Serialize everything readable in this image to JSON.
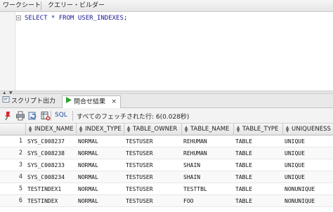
{
  "editor_tabs": {
    "worksheet": "ワークシート",
    "query_builder": "クエリー・ビルダー"
  },
  "editor": {
    "sql": "SELECT * FROM USER_INDEXES;"
  },
  "result_tabs": {
    "script_output": "スクリプト出力",
    "query_result": "問合せ結果",
    "close_symbol": "×"
  },
  "toolbar": {
    "sql_label": "SQL",
    "status": "すべてのフェッチされた行: 6(0.028秒)"
  },
  "grid": {
    "columns": [
      "INDEX_NAME",
      "INDEX_TYPE",
      "TABLE_OWNER",
      "TABLE_NAME",
      "TABLE_TYPE",
      "UNIQUENESS"
    ],
    "rows": [
      {
        "num": "1",
        "cells": [
          "SYS_C008237",
          "NORMAL",
          "TESTUSER",
          "REHUMAN",
          "TABLE",
          "UNIQUE"
        ]
      },
      {
        "num": "2",
        "cells": [
          "SYS_C008238",
          "NORMAL",
          "TESTUSER",
          "REHUMAN",
          "TABLE",
          "UNIQUE"
        ]
      },
      {
        "num": "3",
        "cells": [
          "SYS_C008233",
          "NORMAL",
          "TESTUSER",
          "SHAIN",
          "TABLE",
          "UNIQUE"
        ]
      },
      {
        "num": "4",
        "cells": [
          "SYS_C008234",
          "NORMAL",
          "TESTUSER",
          "SHAIN",
          "TABLE",
          "UNIQUE"
        ]
      },
      {
        "num": "5",
        "cells": [
          "TESTINDEX1",
          "NORMAL",
          "TESTUSER",
          "TESTTBL",
          "TABLE",
          "NONUNIQUE"
        ]
      },
      {
        "num": "6",
        "cells": [
          "TESTINDEX",
          "NORMAL",
          "TESTUSER",
          "FOO",
          "TABLE",
          "NONUNIQUE"
        ]
      }
    ]
  },
  "icons": {
    "pin": "pin-icon",
    "print": "print-icon",
    "refresh": "refresh-icon",
    "export": "export-icon",
    "script": "script-output-icon",
    "run": "run-icon",
    "sort": "sort-icon",
    "collapse": "collapse-icon"
  },
  "colors": {
    "sql_text": "#1a1a9a",
    "run_green": "#2d9d2d",
    "pin_red": "#d9262b"
  }
}
